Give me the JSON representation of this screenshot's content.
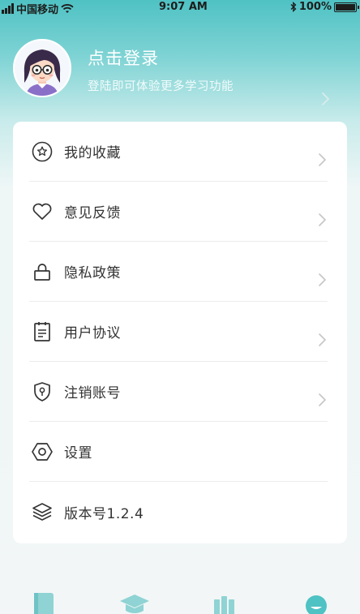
{
  "status_bar": {
    "carrier": "中国移动",
    "time": "9:07 AM",
    "battery": "100%",
    "battery_level": 1.0
  },
  "header": {
    "login_title": "点击登录",
    "login_subtitle": "登陆即可体验更多学习功能"
  },
  "menu": {
    "items": [
      {
        "label": "我的收藏",
        "icon": "star-circle-icon"
      },
      {
        "label": "意见反馈",
        "icon": "heart-icon"
      },
      {
        "label": "隐私政策",
        "icon": "lock-icon"
      },
      {
        "label": "用户协议",
        "icon": "clipboard-icon"
      },
      {
        "label": "注销账号",
        "icon": "shield-icon"
      },
      {
        "label": "设置",
        "icon": "hexagon-settings-icon"
      },
      {
        "label": "版本号1.2.4",
        "icon": "layers-icon"
      }
    ]
  },
  "tabbar": {
    "tabs": [
      {
        "icon": "book-icon"
      },
      {
        "icon": "graduation-cap-icon"
      },
      {
        "icon": "books-shelf-icon"
      },
      {
        "icon": "profile-face-icon"
      }
    ]
  },
  "colors": {
    "accent": "#4fc2c4",
    "tab_icon": "#8fd3d4",
    "text": "#333333"
  }
}
